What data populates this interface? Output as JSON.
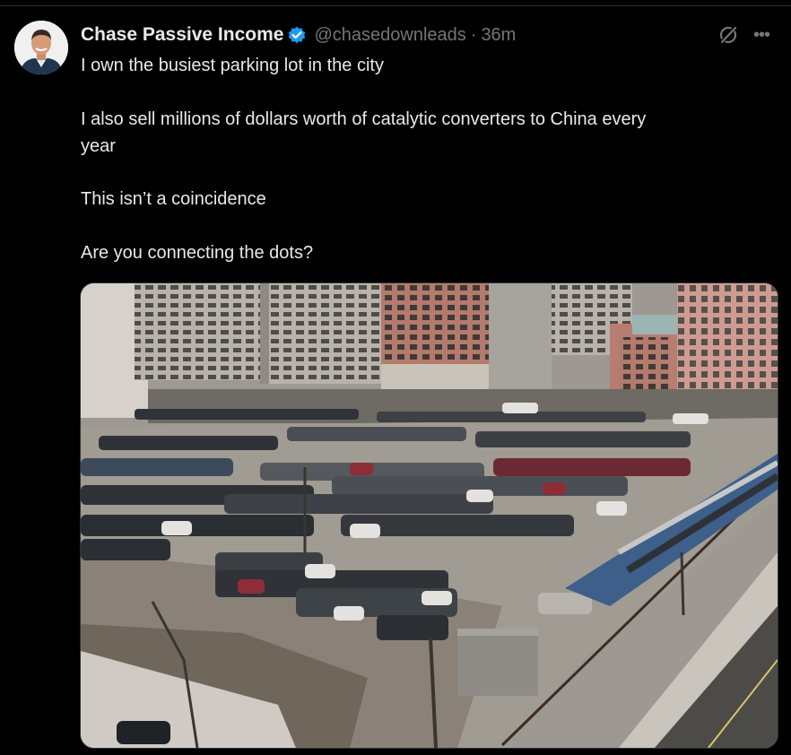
{
  "tweet": {
    "author": {
      "display_name": "Chase Passive Income",
      "handle": "@chasedownleads",
      "separator": "·",
      "time": "36m",
      "verified": true
    },
    "text_lines": [
      "I own the busiest parking lot in the city",
      "I also sell millions of dollars worth of catalytic converters to China every",
      "year",
      "This isn’t a coincidence",
      "Are you connecting the dots?"
    ],
    "media": {
      "type": "video",
      "subject": "aerial-parking-lot"
    }
  },
  "icons": {
    "verified": "verified-badge-icon",
    "grok": "grok-icon",
    "more": "more-icon"
  },
  "colors": {
    "background": "#000000",
    "text_primary": "#e7e9ea",
    "text_secondary": "#71767b",
    "verified_blue": "#1d9bf0",
    "border": "#2f3336"
  }
}
